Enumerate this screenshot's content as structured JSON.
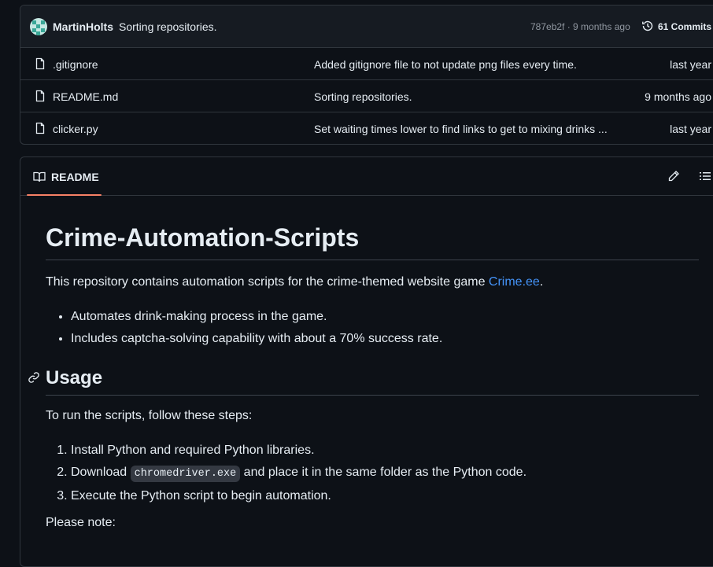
{
  "commit": {
    "author": "MartinHolts",
    "message": "Sorting repositories.",
    "meta": "787eb2f · 9 months ago",
    "commits_label": "61 Commits"
  },
  "files": [
    {
      "name": ".gitignore",
      "message": "Added gitignore file to not update png files every time.",
      "age": "last year"
    },
    {
      "name": "README.md",
      "message": "Sorting repositories.",
      "age": "9 months ago"
    },
    {
      "name": "clicker.py",
      "message": "Set waiting times lower to find links to get to mixing drinks ...",
      "age": "last year"
    }
  ],
  "readme": {
    "tab_label": "README",
    "title": "Crime-Automation-Scripts",
    "intro_prefix": "This repository contains automation scripts for the crime-themed website game ",
    "intro_link": "Crime.ee",
    "intro_suffix": ".",
    "features": [
      "Automates drink-making process in the game.",
      "Includes captcha-solving capability with about a 70% success rate."
    ],
    "usage_heading": "Usage",
    "usage_intro": "To run the scripts, follow these steps:",
    "steps": {
      "step1": "Install Python and required Python libraries.",
      "step2_prefix": "Download ",
      "step2_code": "chromedriver.exe",
      "step2_suffix": " and place it in the same folder as the Python code.",
      "step3": "Execute the Python script to begin automation."
    },
    "note": "Please note:"
  },
  "icons": {
    "commit_history": "history-icon",
    "file": "file-icon",
    "readme_tab": "book-icon",
    "edit": "pencil-icon",
    "outline": "list-icon",
    "anchor": "link-icon"
  },
  "colors": {
    "background": "#0d1117",
    "header_bg": "#161b22",
    "border": "#30363d",
    "link": "#4493f8",
    "tab_underline": "#f78166"
  }
}
